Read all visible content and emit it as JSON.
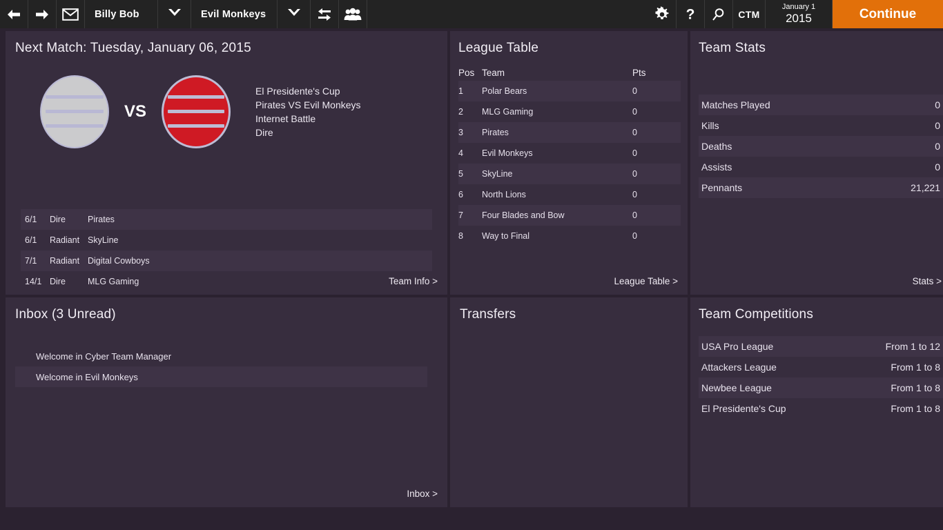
{
  "topbar": {
    "back_icon": "arrow-left-icon",
    "forward_icon": "arrow-right-icon",
    "mail_icon": "envelope-icon",
    "manager_name": "Billy Bob",
    "manager_caret": "chevron-down-icon",
    "team_name": "Evil Monkeys",
    "team_caret": "chevron-down-icon",
    "transfer_icon": "swap-arrows-icon",
    "squad_icon": "people-icon",
    "settings_icon": "gear-icon",
    "help_icon": "question-mark-icon",
    "search_icon": "magnifier-icon",
    "ctm_label": "CTM",
    "date_day": "January 1",
    "date_year": "2015",
    "continue_label": "Continue",
    "accent_color": "#e2700a"
  },
  "next_match": {
    "title": "Next Match: Tuesday, January 06, 2015",
    "home_crest_color": "#cbcbcd",
    "away_crest_color": "#cf1a24",
    "vs_label": "VS",
    "info_lines": [
      "El Presidente's Cup",
      "Pirates VS Evil Monkeys",
      "Internet Battle",
      "Dire"
    ],
    "odds": [
      {
        "odds": "6/1",
        "side": "Dire",
        "team": "Pirates"
      },
      {
        "odds": "6/1",
        "side": "Radiant",
        "team": "SkyLine"
      },
      {
        "odds": "7/1",
        "side": "Radiant",
        "team": "Digital Cowboys"
      },
      {
        "odds": "14/1",
        "side": "Dire",
        "team": "MLG Gaming"
      }
    ],
    "link": "Team Info >"
  },
  "league_table": {
    "title": "League Table",
    "columns": {
      "pos": "Pos",
      "team": "Team",
      "pts": "Pts"
    },
    "rows": [
      {
        "pos": "1",
        "team": "Polar Bears",
        "pts": "0"
      },
      {
        "pos": "2",
        "team": "MLG Gaming",
        "pts": "0"
      },
      {
        "pos": "3",
        "team": "Pirates",
        "pts": "0"
      },
      {
        "pos": "4",
        "team": "Evil Monkeys",
        "pts": "0"
      },
      {
        "pos": "5",
        "team": "SkyLine",
        "pts": "0"
      },
      {
        "pos": "6",
        "team": "North Lions",
        "pts": "0"
      },
      {
        "pos": "7",
        "team": "Four Blades and Bow",
        "pts": "0"
      },
      {
        "pos": "8",
        "team": "Way to Final",
        "pts": "0"
      }
    ],
    "link": "League Table >"
  },
  "team_stats": {
    "title": "Team Stats",
    "rows": [
      {
        "label": "Matches Played",
        "value": "0"
      },
      {
        "label": "Kills",
        "value": "0"
      },
      {
        "label": "Deaths",
        "value": "0"
      },
      {
        "label": "Assists",
        "value": "0"
      },
      {
        "label": "Pennants",
        "value": "21,221"
      }
    ],
    "link": "Stats >"
  },
  "inbox": {
    "title": "Inbox (3 Unread)",
    "messages": [
      {
        "subject": "Welcome in Cyber Team Manager"
      },
      {
        "subject": "Welcome in Evil Monkeys"
      }
    ],
    "link": "Inbox >"
  },
  "transfers": {
    "title": "Transfers"
  },
  "team_competitions": {
    "title": "Team Competitions",
    "rows": [
      {
        "label": "USA Pro League",
        "value": "From 1 to 12"
      },
      {
        "label": "Attackers League",
        "value": "From 1 to 8"
      },
      {
        "label": "Newbee League",
        "value": "From 1 to 8"
      },
      {
        "label": "El Presidente's Cup",
        "value": "From 1 to 8"
      }
    ]
  }
}
